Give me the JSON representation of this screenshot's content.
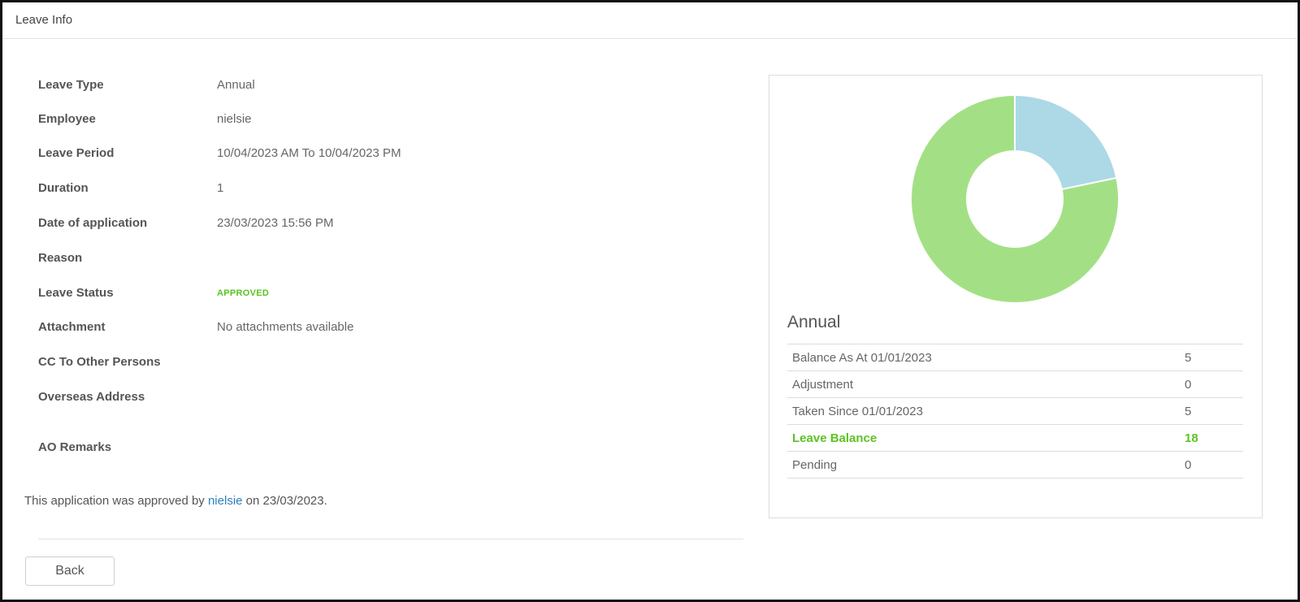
{
  "panel": {
    "title": "Leave Info"
  },
  "details": [
    {
      "label": "Leave Type",
      "value": "Annual"
    },
    {
      "label": "Employee",
      "value": "nielsie"
    },
    {
      "label": "Leave Period",
      "value": "10/04/2023 AM To 10/04/2023 PM"
    },
    {
      "label": "Duration",
      "value": "1"
    },
    {
      "label": "Date of application",
      "value": "23/03/2023 15:56 PM"
    },
    {
      "label": "Reason",
      "value": ""
    },
    {
      "label": "Leave Status",
      "value": "APPROVED"
    },
    {
      "label": "Attachment",
      "value": "No attachments available"
    },
    {
      "label": "CC To Other Persons",
      "value": ""
    },
    {
      "label": "Overseas Address",
      "value": ""
    },
    {
      "label": "AO Remarks",
      "value": ""
    }
  ],
  "approval": {
    "prefix": "This application was approved by",
    "approver": "nielsie",
    "suffix": "on 23/03/2023."
  },
  "actions": {
    "back_label": "Back"
  },
  "summary": {
    "title": "Annual",
    "rows": [
      {
        "label": "Balance As At 01/01/2023",
        "value": "5"
      },
      {
        "label": "Adjustment",
        "value": "0"
      },
      {
        "label": "Taken Since 01/01/2023",
        "value": "5"
      },
      {
        "label": "Leave Balance",
        "value": "18"
      },
      {
        "label": "Pending",
        "value": "0"
      }
    ]
  },
  "chart_data": {
    "type": "pie",
    "donut": true,
    "slices": [
      {
        "value": 5,
        "color": "#add8e6"
      },
      {
        "value": 18,
        "color": "#a3e085"
      }
    ]
  },
  "colors": {
    "approved_green": "#5cc324",
    "link_blue": "#2d7fbd"
  }
}
